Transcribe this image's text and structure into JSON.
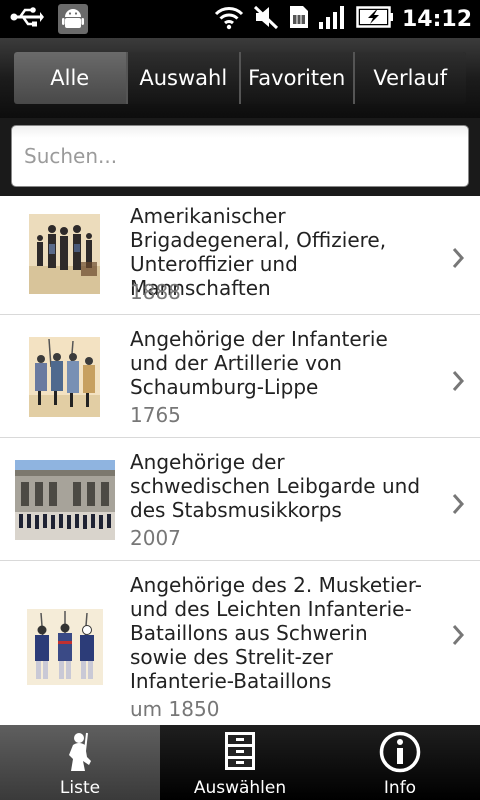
{
  "status_bar": {
    "time": "14:12",
    "icons": [
      "usb-icon",
      "android-debug-icon",
      "wifi-icon",
      "mute-icon",
      "sim-icon",
      "signal-icon",
      "battery-charging-icon"
    ]
  },
  "tabs": [
    {
      "label": "Alle",
      "active": true
    },
    {
      "label": "Auswahl",
      "active": false
    },
    {
      "label": "Favoriten",
      "active": false
    },
    {
      "label": "Verlauf",
      "active": false
    }
  ],
  "search": {
    "placeholder": "Suchen..."
  },
  "items": [
    {
      "title": "Amerikanischer Brigadegeneral, Offiziere, Unteroffizier und Mannschaften",
      "year": "1888",
      "thumbnail": "soldiers-illustration"
    },
    {
      "title": "Angehörige der Infanterie und der Artillerie von Schaumburg-Lippe",
      "year": "1765",
      "thumbnail": "soldiers-illustration"
    },
    {
      "title": "Angehörige der schwedischen Leibgarde und des Stabsmusikkorps",
      "year": "2007",
      "thumbnail": "parade-photo"
    },
    {
      "title": "Angehörige des 2. Musketier- und des Leichten Infanterie-Bataillons aus Schwerin sowie des Strelit-zer Infanterie-Bataillons",
      "year": "um 1850",
      "thumbnail": "soldiers-illustration"
    }
  ],
  "bottom_nav": [
    {
      "label": "Liste",
      "icon": "list-soldier-icon",
      "active": true
    },
    {
      "label": "Auswählen",
      "icon": "cabinet-icon",
      "active": false
    },
    {
      "label": "Info",
      "icon": "info-icon",
      "active": false
    }
  ]
}
